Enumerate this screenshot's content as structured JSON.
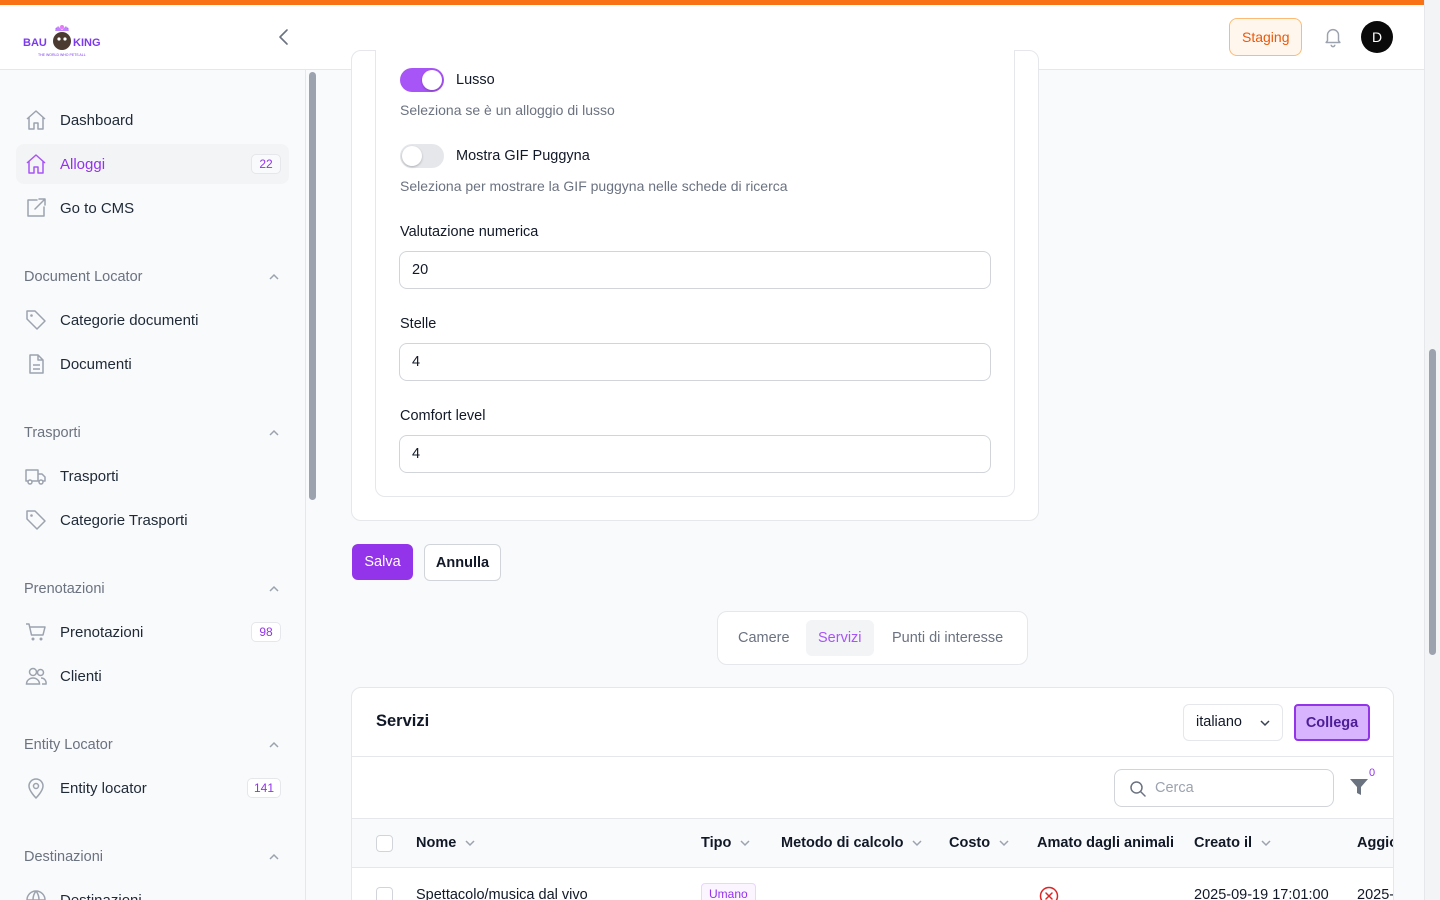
{
  "header": {
    "logo_text_left": "BAU",
    "logo_text_right": "KING",
    "logo_tagline": "THE WORLD WHO PETS ALL",
    "env_button": "Staging",
    "avatar_initial": "D",
    "accent_color": "#f97316"
  },
  "sidebar": {
    "top_items": [
      {
        "label": "Dashboard",
        "icon": "home-icon"
      },
      {
        "label": "Alloggi",
        "icon": "home-icon",
        "count": "22",
        "active": true
      },
      {
        "label": "Go to CMS",
        "icon": "external-link-icon"
      }
    ],
    "groups": [
      {
        "title": "Document Locator",
        "items": [
          {
            "label": "Categorie documenti",
            "icon": "tag-icon"
          },
          {
            "label": "Documenti",
            "icon": "file-icon"
          }
        ]
      },
      {
        "title": "Trasporti",
        "items": [
          {
            "label": "Trasporti",
            "icon": "truck-icon"
          },
          {
            "label": "Categorie Trasporti",
            "icon": "tag-icon"
          }
        ]
      },
      {
        "title": "Prenotazioni",
        "items": [
          {
            "label": "Prenotazioni",
            "icon": "cart-icon",
            "count": "98"
          },
          {
            "label": "Clienti",
            "icon": "users-icon"
          }
        ]
      },
      {
        "title": "Entity Locator",
        "items": [
          {
            "label": "Entity locator",
            "icon": "map-pin-icon",
            "count": "141"
          }
        ]
      },
      {
        "title": "Destinazioni",
        "items": [
          {
            "label": "Destinazioni",
            "icon": "globe-icon"
          }
        ]
      }
    ]
  },
  "form": {
    "luxury_toggle": {
      "label": "Lusso",
      "on": true,
      "helper": "Seleziona se è un alloggio di lusso"
    },
    "gif_toggle": {
      "label": "Mostra GIF Puggyna",
      "on": false,
      "helper": "Seleziona per mostrare la GIF puggyna nelle schede di ricerca"
    },
    "rating": {
      "label": "Valutazione numerica",
      "value": "20"
    },
    "stars": {
      "label": "Stelle",
      "value": "4"
    },
    "comfort": {
      "label": "Comfort level",
      "value": "4"
    },
    "save_label": "Salva",
    "cancel_label": "Annulla"
  },
  "tabs": [
    {
      "label": "Camere",
      "active": false
    },
    {
      "label": "Servizi",
      "active": true
    },
    {
      "label": "Punti di interesse",
      "active": false
    }
  ],
  "services_table": {
    "title": "Servizi",
    "language": "italiano",
    "link_button": "Collega",
    "search_placeholder": "Cerca",
    "filter_count": "0",
    "columns": [
      "Nome",
      "Tipo",
      "Metodo di calcolo",
      "Costo",
      "Amato dagli animali",
      "Creato il",
      "Aggio"
    ],
    "rows": [
      {
        "nome": "Spettacolo/musica dal vivo",
        "tipo": "Umano",
        "metodo": "",
        "costo": "",
        "amato": false,
        "creato": "2025-09-19 17:01:00",
        "aggiornato": "2025-"
      }
    ]
  }
}
